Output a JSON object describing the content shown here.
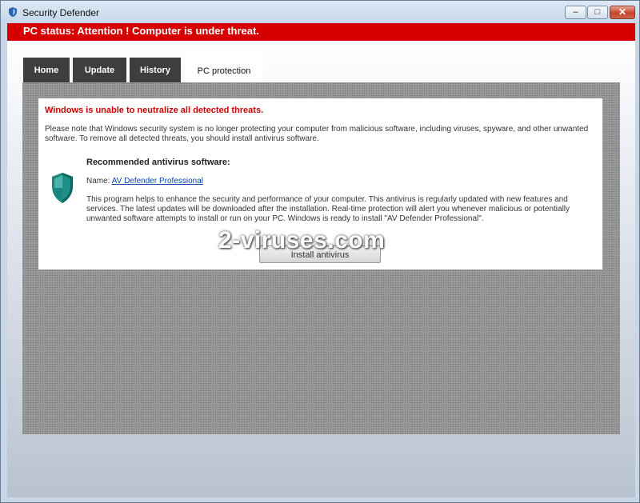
{
  "window": {
    "title": "Security Defender",
    "controls": {
      "minimize": "–",
      "maximize": "□",
      "close": "✕"
    }
  },
  "status": {
    "text": "PC status: Attention ! Computer is under threat.",
    "color": "#d70000"
  },
  "tabs": [
    {
      "label": "Home"
    },
    {
      "label": "Update"
    },
    {
      "label": "History"
    },
    {
      "label": "PC protection",
      "active": true
    }
  ],
  "protection": {
    "warning": "Windows is unable to neutralize all detected threats.",
    "description": "Please note that Windows security system is no longer protecting your computer from malicious software, including viruses, spyware, and other unwanted software. To remove all detected threats, you should install antivirus software.",
    "recommended_title": "Recommended antivirus software:",
    "name_label": "Name: ",
    "product_name": "AV Defender Professional",
    "product_description": "This program helps to enhance the security and performance of your computer. This antivirus is regularly updated with new features and services. The latest updates will be downloaded after the installation. Real-time protection will alert you whenever malicious or potentially unwanted software attempts to install or run on your PC. Windows is ready to install \"AV Defender Professional\".",
    "install_button": "Install antivirus",
    "shield_icon": "shield-icon"
  },
  "watermark": "2-viruses.com"
}
